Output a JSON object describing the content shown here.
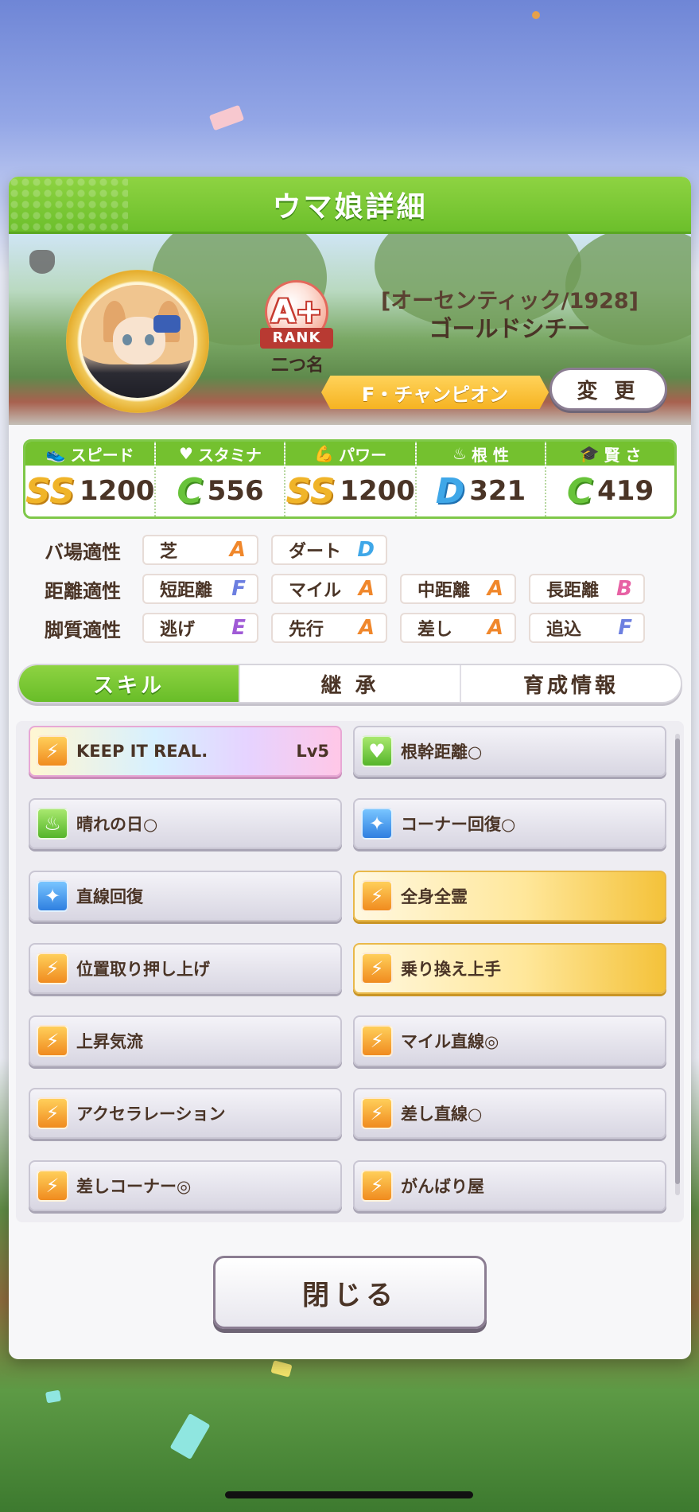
{
  "header": {
    "title": "ウマ娘詳細"
  },
  "profile": {
    "rank_letter": "A+",
    "rank_ribbon": "RANK",
    "rank_caption": "二つ名",
    "title_line": "[オーセンティック/1928]",
    "name": "ゴールドシチー",
    "epithet": "F・チャンピオン",
    "change_label": "変 更"
  },
  "stats": [
    {
      "label": "スピード",
      "icon": "shoe-icon",
      "grade": "SS",
      "value": "1200"
    },
    {
      "label": "スタミナ",
      "icon": "heart-icon",
      "grade": "C",
      "value": "556"
    },
    {
      "label": "パワー",
      "icon": "muscle-icon",
      "grade": "SS",
      "value": "1200"
    },
    {
      "label": "根 性",
      "icon": "flame-icon",
      "grade": "D",
      "value": "321"
    },
    {
      "label": "賢 さ",
      "icon": "grad-cap-icon",
      "grade": "C",
      "value": "419"
    }
  ],
  "aptitude": {
    "track": {
      "label": "バ場適性",
      "items": [
        {
          "name": "芝",
          "grade": "A"
        },
        {
          "name": "ダート",
          "grade": "D"
        }
      ]
    },
    "distance": {
      "label": "距離適性",
      "items": [
        {
          "name": "短距離",
          "grade": "F"
        },
        {
          "name": "マイル",
          "grade": "A"
        },
        {
          "name": "中距離",
          "grade": "A"
        },
        {
          "name": "長距離",
          "grade": "B"
        }
      ]
    },
    "style": {
      "label": "脚質適性",
      "items": [
        {
          "name": "逃げ",
          "grade": "E"
        },
        {
          "name": "先行",
          "grade": "A"
        },
        {
          "name": "差し",
          "grade": "A"
        },
        {
          "name": "追込",
          "grade": "F"
        }
      ]
    }
  },
  "tabs": [
    {
      "label": "スキル",
      "active": true
    },
    {
      "label": "継 承",
      "active": false
    },
    {
      "label": "育成情報",
      "active": false
    }
  ],
  "skills": [
    {
      "name": "KEEP IT REAL.",
      "level": "Lv5",
      "icon": "speed-icon",
      "style": "rainbow"
    },
    {
      "name": "根幹距離○",
      "level": "",
      "icon": "heart-icon",
      "style": "normal"
    },
    {
      "name": "晴れの日○",
      "level": "",
      "icon": "green-flame-icon",
      "style": "normal"
    },
    {
      "name": "コーナー回復○",
      "level": "",
      "icon": "heal-sparkle-icon",
      "style": "normal"
    },
    {
      "name": "直線回復",
      "level": "",
      "icon": "heal-sparkle-icon",
      "style": "normal"
    },
    {
      "name": "全身全霊",
      "level": "",
      "icon": "speed-icon",
      "style": "gold"
    },
    {
      "name": "位置取り押し上げ",
      "level": "",
      "icon": "speed-icon",
      "style": "normal"
    },
    {
      "name": "乗り換え上手",
      "level": "",
      "icon": "speed-icon",
      "style": "gold"
    },
    {
      "name": "上昇気流",
      "level": "",
      "icon": "speed-icon",
      "style": "normal"
    },
    {
      "name": "マイル直線◎",
      "level": "",
      "icon": "speed-icon",
      "style": "normal"
    },
    {
      "name": "アクセラレーション",
      "level": "",
      "icon": "speed-icon",
      "style": "normal"
    },
    {
      "name": "差し直線○",
      "level": "",
      "icon": "speed-icon",
      "style": "normal"
    },
    {
      "name": "差しコーナー◎",
      "level": "",
      "icon": "speed-icon",
      "style": "normal"
    },
    {
      "name": "がんばり屋",
      "level": "",
      "icon": "speed-icon",
      "style": "normal"
    }
  ],
  "footer": {
    "close_label": "閉じる"
  }
}
